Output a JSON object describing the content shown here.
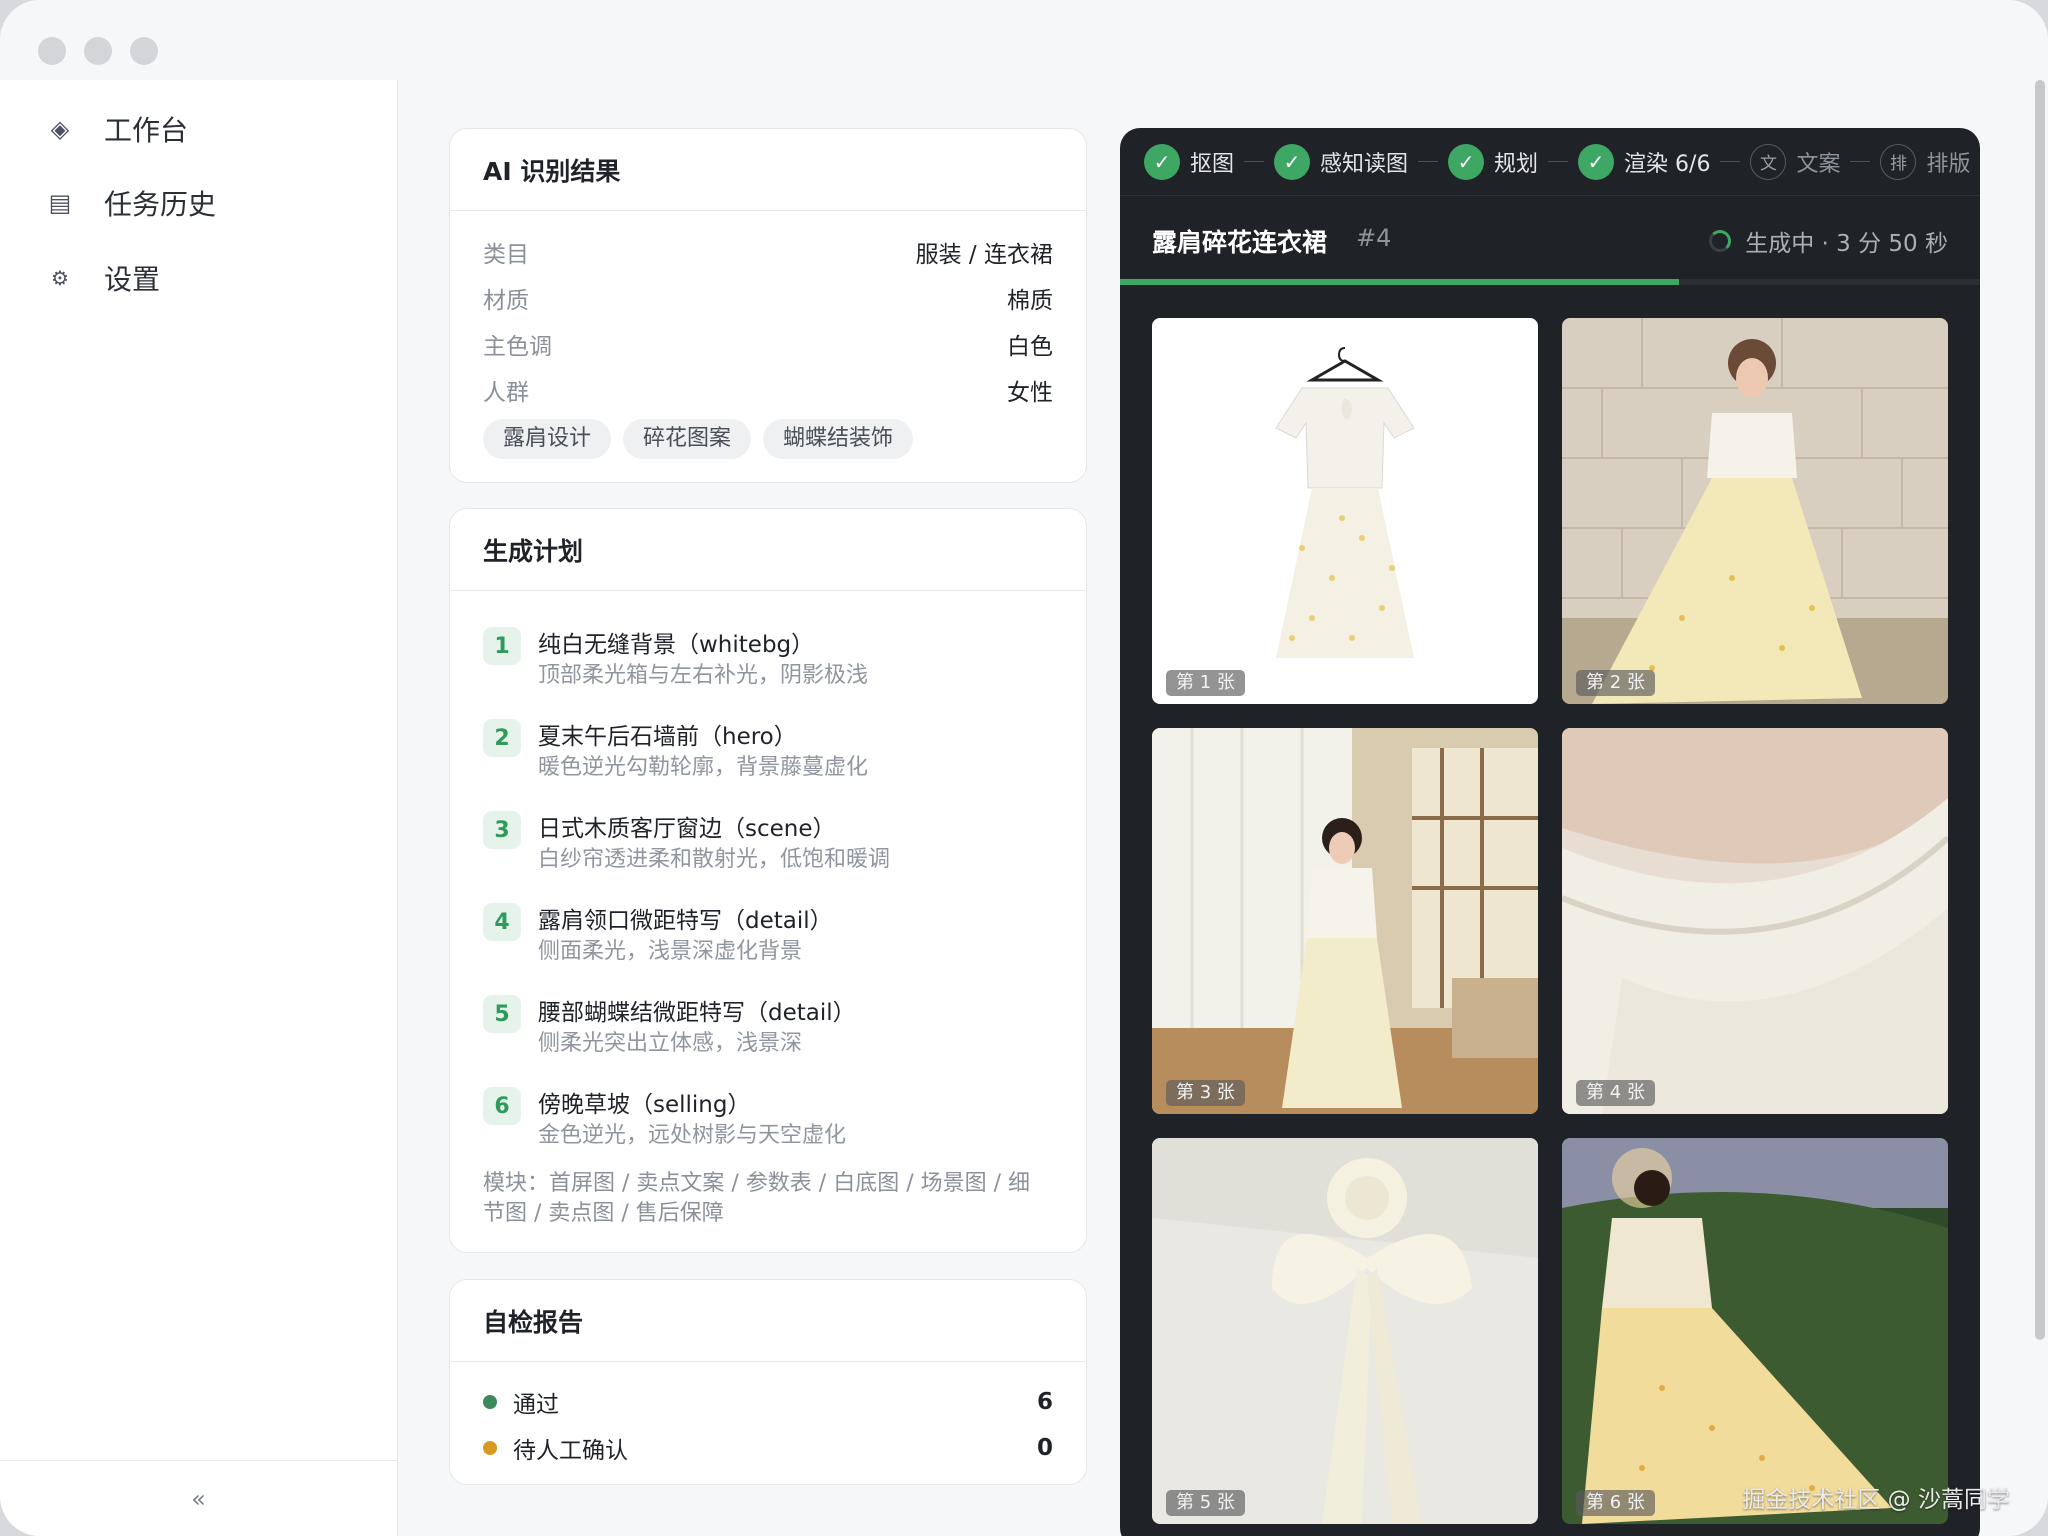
{
  "sidebar": {
    "items": [
      {
        "icon": "diamond-icon",
        "label": "工作台"
      },
      {
        "icon": "list-icon",
        "label": "任务历史"
      },
      {
        "icon": "gear-icon",
        "label": "设置"
      }
    ],
    "collapse_label": "«"
  },
  "ai_result": {
    "title": "AI 识别结果",
    "rows": [
      {
        "key": "类目",
        "value": "服装 / 连衣裙"
      },
      {
        "key": "材质",
        "value": "棉质"
      },
      {
        "key": "主色调",
        "value": "白色"
      },
      {
        "key": "人群",
        "value": "女性"
      }
    ],
    "tags": [
      "露肩设计",
      "碎花图案",
      "蝴蝶结装饰"
    ]
  },
  "plan": {
    "title": "生成计划",
    "items": [
      {
        "num": "1",
        "title": "纯白无缝背景（whitebg）",
        "sub": "顶部柔光箱与左右补光，阴影极浅"
      },
      {
        "num": "2",
        "title": "夏末午后石墙前（hero）",
        "sub": "暖色逆光勾勒轮廓，背景藤蔓虚化"
      },
      {
        "num": "3",
        "title": "日式木质客厅窗边（scene）",
        "sub": "白纱帘透进柔和散射光，低饱和暖调"
      },
      {
        "num": "4",
        "title": "露肩领口微距特写（detail）",
        "sub": "侧面柔光，浅景深虚化背景"
      },
      {
        "num": "5",
        "title": "腰部蝴蝶结微距特写（detail）",
        "sub": "侧柔光突出立体感，浅景深"
      },
      {
        "num": "6",
        "title": "傍晚草坡（selling）",
        "sub": "金色逆光，远处树影与天空虚化"
      }
    ],
    "modules": "模块：首屏图 / 卖点文案 / 参数表 / 白底图 / 场景图 / 细节图 / 卖点图 / 售后保障"
  },
  "check": {
    "title": "自检报告",
    "rows": [
      {
        "label": "通过",
        "count": "6",
        "color": "#3c8a5a"
      },
      {
        "label": "待人工确认",
        "count": "0",
        "color": "#d69a1e"
      }
    ]
  },
  "panel": {
    "steps": [
      {
        "label": "抠图",
        "state": "done",
        "glyph": "✓"
      },
      {
        "label": "感知读图",
        "state": "done",
        "glyph": "✓"
      },
      {
        "label": "规划",
        "state": "done",
        "glyph": "✓"
      },
      {
        "label": "渲染 6/6",
        "state": "done",
        "glyph": "✓"
      },
      {
        "label": "文案",
        "state": "todo",
        "glyph": "文"
      },
      {
        "label": "排版",
        "state": "todo",
        "glyph": "排"
      }
    ],
    "task_title": "露肩碎花连衣裙",
    "task_id": "#4",
    "status": "生成中 · 3 分 50 秒",
    "progress": 0.65,
    "images": [
      {
        "label": "第 1 张"
      },
      {
        "label": "第 2 张"
      },
      {
        "label": "第 3 张"
      },
      {
        "label": "第 4 张"
      },
      {
        "label": "第 5 张"
      },
      {
        "label": "第 6 张"
      }
    ]
  },
  "watermark": "掘金技术社区 @ 沙蒿同学",
  "colors": {
    "accent": "#3fa764",
    "panel_bg": "#1f2227"
  }
}
